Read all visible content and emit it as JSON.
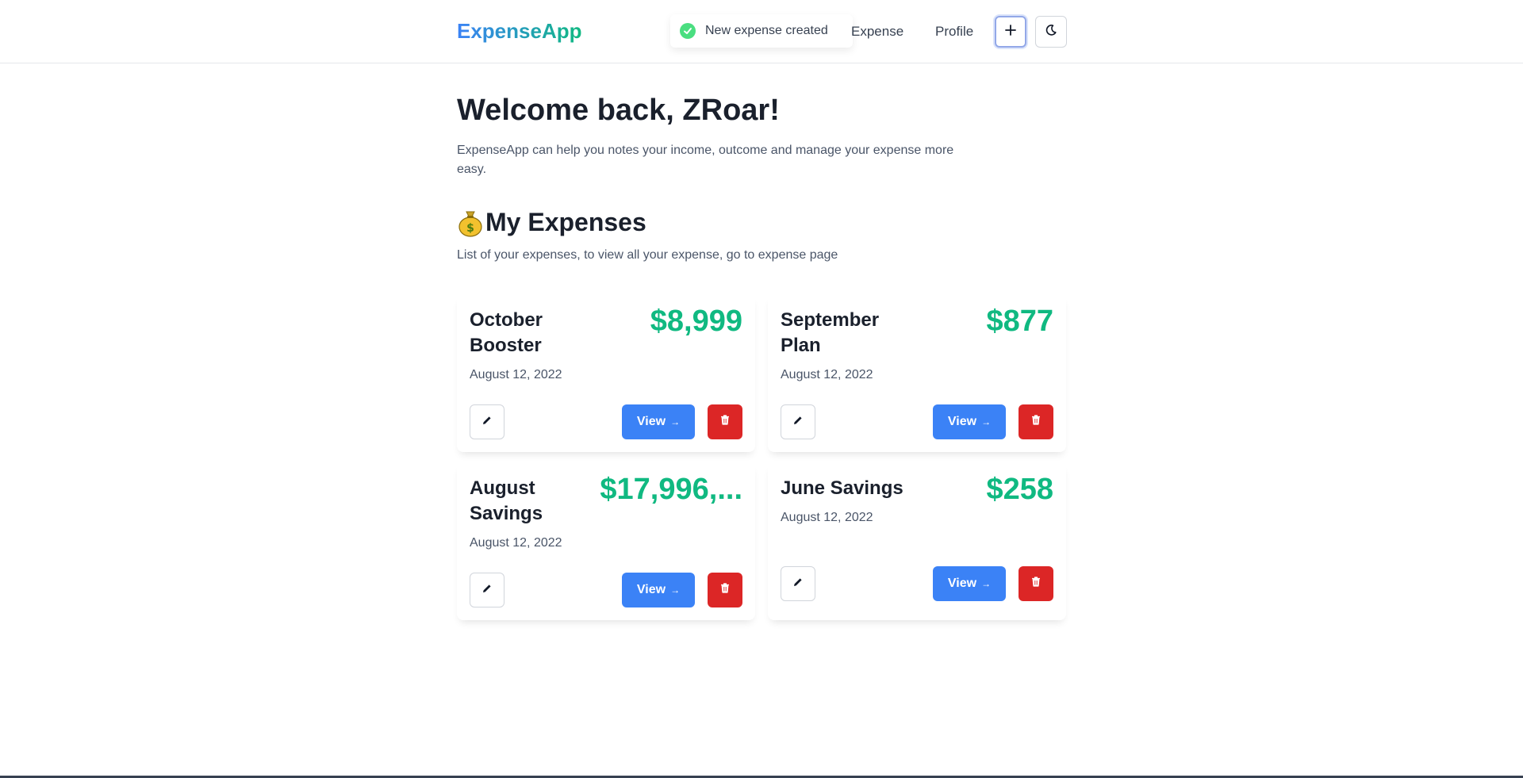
{
  "navbar": {
    "brand": "ExpenseApp",
    "links": [
      "Expense",
      "Profile"
    ],
    "add_label": "+",
    "theme_icon": "moon-icon"
  },
  "toast": {
    "message": "New expense created",
    "icon": "check-circle-icon",
    "color": "#4ade80"
  },
  "hero": {
    "title": "Welcome back, ZRoar!",
    "description": "ExpenseApp can help you notes your income, outcome and manage your expense more easy."
  },
  "section": {
    "emoji": "money-bag-icon",
    "title": "My Expenses",
    "subtitle": "List of your expenses, to view all your expense, go to expense page"
  },
  "expenses": [
    {
      "title": "October Booster",
      "amount": "$8,999",
      "date": "August 12, 2022"
    },
    {
      "title": "September Plan",
      "amount": "$877",
      "date": "August 12, 2022"
    },
    {
      "title": "August Savings",
      "amount": "$17,996,...",
      "date": "August 12, 2022"
    },
    {
      "title": "June Savings",
      "amount": "$258",
      "date": "August 12, 2022"
    }
  ],
  "card_actions": {
    "view_label": "View",
    "view_arrow": "→",
    "edit_icon": "pencil-icon",
    "delete_icon": "trash-icon"
  },
  "colors": {
    "amount": "#10b981",
    "view_button": "#3b82f6",
    "delete_button": "#dc2626",
    "brand_gradient": [
      "#3b82f6",
      "#10b981"
    ]
  }
}
